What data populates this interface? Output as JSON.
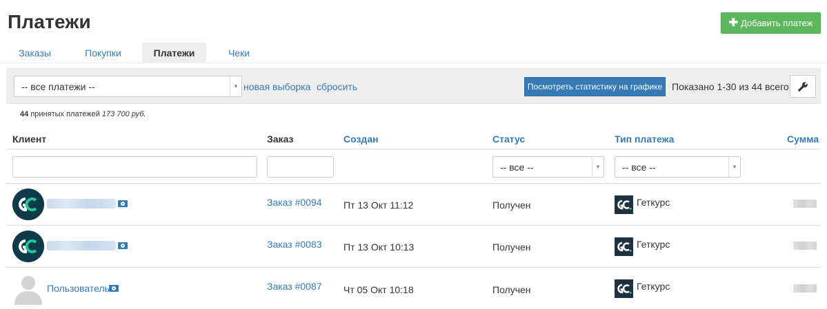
{
  "page": {
    "title": "Платежи",
    "add_button_label": "Добавить платеж"
  },
  "tabs": [
    {
      "label": "Заказы"
    },
    {
      "label": "Покупки"
    },
    {
      "label": "Платежи"
    },
    {
      "label": "Чеки"
    }
  ],
  "filters": {
    "payment_select_value": "-- все платежи --",
    "new_selection_label": "новая выборка",
    "reset_label": "сбросить",
    "stats_button_label": "Посмотреть статистику на графике",
    "shown_text": "Показано 1-30 из 44 всего."
  },
  "summary": {
    "count": "44",
    "count_label": "принятых платежей",
    "total": "173 700 руб."
  },
  "table": {
    "columns": [
      "Клиент",
      "Заказ",
      "Создан",
      "Статус",
      "Тип платежа",
      "Сумма"
    ],
    "status_filter_value": "-- все --",
    "type_filter_value": "-- все --",
    "rows": [
      {
        "client": "",
        "client_avatar": "gc-logo",
        "order": "Заказ #0094",
        "created": "Пт 13 Окт 11:12",
        "status": "Получен",
        "type": "Геткурс",
        "amount": ""
      },
      {
        "client": "",
        "client_avatar": "gc-logo",
        "order": "Заказ #0083",
        "created": "Пт 13 Окт 10:13",
        "status": "Получен",
        "type": "Геткурс",
        "amount": ""
      },
      {
        "client": "Пользователь",
        "client_avatar": "default-user",
        "order": "Заказ #0087",
        "created": "Чт 05 Окт 10:18",
        "status": "Получен",
        "type": "Геткурс",
        "amount": ""
      }
    ]
  },
  "colors": {
    "accent_link": "#337ab7",
    "success_button": "#5cb85c",
    "gc_avatar_bg": "#0e3a4a",
    "gc_logo_accent": "#20c997"
  },
  "icons": {
    "add": "plus-icon",
    "settings": "wrench-icon",
    "money": "money-icon",
    "dropdown": "caret-down-icon"
  }
}
